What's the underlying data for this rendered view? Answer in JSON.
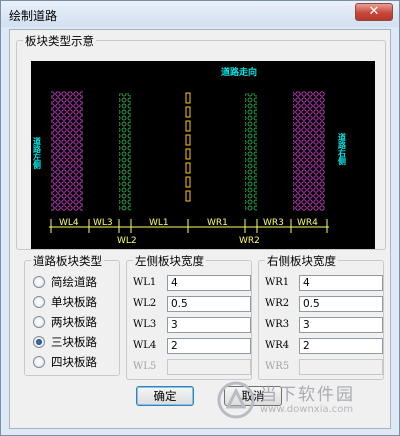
{
  "window": {
    "title": "绘制道路",
    "close_glyph": "✕"
  },
  "preview_group": {
    "title": "板块类型示意",
    "direction_label": "道路走向",
    "left_side_label": "道路左侧",
    "right_side_label": "道路右侧",
    "dimension_labels": [
      "WL4",
      "WL3",
      "WL2",
      "WL1",
      "WR1",
      "WR2",
      "WR3",
      "WR4"
    ],
    "colors": {
      "background": "#000000",
      "sidewalk": "#cc44cc",
      "green_strip": "#22aa44",
      "center_line": "#ffcc00",
      "dimension": "#ffff66",
      "text": "#00e5e5"
    }
  },
  "road_type_group": {
    "title": "道路板块类型",
    "options": [
      {
        "label": "简绘道路",
        "checked": false
      },
      {
        "label": "单块板路",
        "checked": false
      },
      {
        "label": "两块板路",
        "checked": false
      },
      {
        "label": "三块板路",
        "checked": true
      },
      {
        "label": "四块板路",
        "checked": false
      }
    ]
  },
  "left_width_group": {
    "title": "左侧板块宽度",
    "fields": [
      {
        "label": "WL1",
        "value": "4",
        "enabled": true
      },
      {
        "label": "WL2",
        "value": "0.5",
        "enabled": true
      },
      {
        "label": "WL3",
        "value": "3",
        "enabled": true
      },
      {
        "label": "WL4",
        "value": "2",
        "enabled": true
      },
      {
        "label": "WL5",
        "value": "",
        "enabled": false
      }
    ]
  },
  "right_width_group": {
    "title": "右侧板块宽度",
    "fields": [
      {
        "label": "WR1",
        "value": "4",
        "enabled": true
      },
      {
        "label": "WR2",
        "value": "0.5",
        "enabled": true
      },
      {
        "label": "WR3",
        "value": "3",
        "enabled": true
      },
      {
        "label": "WR4",
        "value": "2",
        "enabled": true
      },
      {
        "label": "WR5",
        "value": "",
        "enabled": false
      }
    ]
  },
  "buttons": {
    "ok": "确定",
    "cancel": "取消"
  },
  "watermark": {
    "brand": "当下软件园",
    "url": "www.downxia.com"
  }
}
